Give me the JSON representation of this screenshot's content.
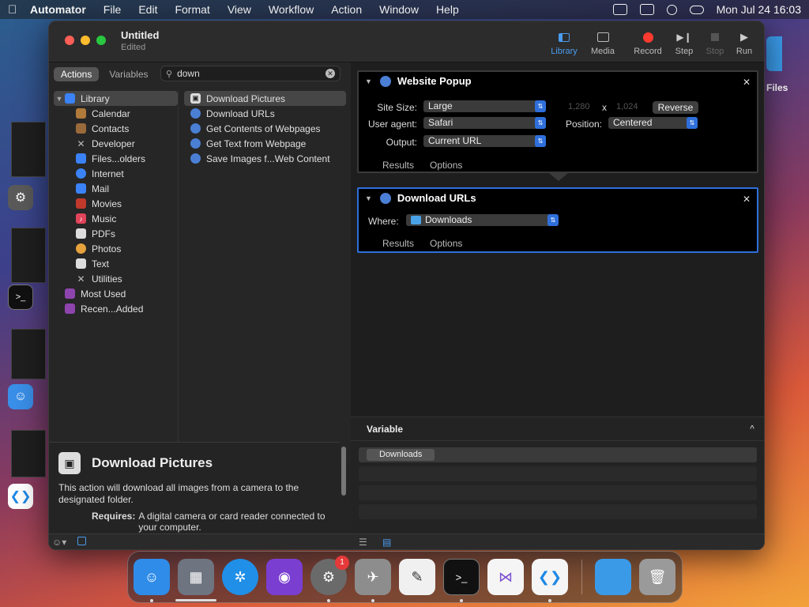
{
  "menubar": {
    "app": "Automator",
    "items": [
      "File",
      "Edit",
      "Format",
      "View",
      "Workflow",
      "Action",
      "Window",
      "Help"
    ],
    "clock": "Mon Jul 24  16:03"
  },
  "desktop": {
    "files_label": "Files"
  },
  "window": {
    "title": "Untitled",
    "subtitle": "Edited",
    "toolbar": {
      "library": "Library",
      "media": "Media",
      "record": "Record",
      "step": "Step",
      "stop": "Stop",
      "run": "Run"
    }
  },
  "library_pane": {
    "tabs": {
      "actions": "Actions",
      "variables": "Variables"
    },
    "search_value": "down",
    "categories": [
      {
        "label": "Library",
        "icon": "library-icon",
        "color": "#3b82f6"
      },
      {
        "label": "Calendar",
        "icon": "calendar-icon",
        "color": "#b07a3b"
      },
      {
        "label": "Contacts",
        "icon": "contacts-icon",
        "color": "#9a6a3b"
      },
      {
        "label": "Developer",
        "icon": "developer-icon",
        "color": "#888888"
      },
      {
        "label": "Files...olders",
        "icon": "finder-icon",
        "color": "#3b82f6"
      },
      {
        "label": "Internet",
        "icon": "internet-icon",
        "color": "#3b82f6"
      },
      {
        "label": "Mail",
        "icon": "mail-icon",
        "color": "#3b82f6"
      },
      {
        "label": "Movies",
        "icon": "movies-icon",
        "color": "#c0392b"
      },
      {
        "label": "Music",
        "icon": "music-icon",
        "color": "#e0445a"
      },
      {
        "label": "PDFs",
        "icon": "pdf-icon",
        "color": "#dddddd"
      },
      {
        "label": "Photos",
        "icon": "photos-icon",
        "color": "#e6a23c"
      },
      {
        "label": "Text",
        "icon": "text-icon",
        "color": "#dddddd"
      },
      {
        "label": "Utilities",
        "icon": "utilities-icon",
        "color": "#888888"
      },
      {
        "label": "Most Used",
        "icon": "smart-folder-icon",
        "color": "#8e44ad"
      },
      {
        "label": "Recen...Added",
        "icon": "smart-folder-icon",
        "color": "#8e44ad"
      }
    ],
    "actions": [
      {
        "label": "Download Pictures",
        "icon": "camera-icon"
      },
      {
        "label": "Download URLs",
        "icon": "automator-icon"
      },
      {
        "label": "Get Contents of Webpages",
        "icon": "automator-icon"
      },
      {
        "label": "Get Text from Webpage",
        "icon": "automator-icon"
      },
      {
        "label": "Save Images f...Web Content",
        "icon": "automator-icon"
      }
    ]
  },
  "description": {
    "title": "Download Pictures",
    "text": "This action will download all images from a camera to the designated folder.",
    "requires_label": "Requires:",
    "requires_text": "A digital camera or card reader connected to your computer."
  },
  "workflow": {
    "website_popup": {
      "title": "Website Popup",
      "site_size_label": "Site Size:",
      "site_size_value": "Large",
      "width_value": "1,280",
      "x_label": "x",
      "height_value": "1,024",
      "reverse_label": "Reverse",
      "user_agent_label": "User agent:",
      "user_agent_value": "Safari",
      "position_label": "Position:",
      "position_value": "Centered",
      "output_label": "Output:",
      "output_value": "Current URL",
      "results_tab": "Results",
      "options_tab": "Options"
    },
    "download_urls": {
      "title": "Download URLs",
      "where_label": "Where:",
      "where_value": "Downloads",
      "results_tab": "Results",
      "options_tab": "Options"
    }
  },
  "variable_pane": {
    "header": "Variable",
    "rows": [
      "Downloads"
    ]
  },
  "dock": {
    "apps": [
      "Finder",
      "Launchpad",
      "Safari",
      "Podcasts",
      "System Settings",
      "Automator",
      "TextEdit",
      "Terminal",
      "Visual Studio",
      "VS Code",
      "Folder",
      "Trash"
    ],
    "settings_badge": "1"
  }
}
